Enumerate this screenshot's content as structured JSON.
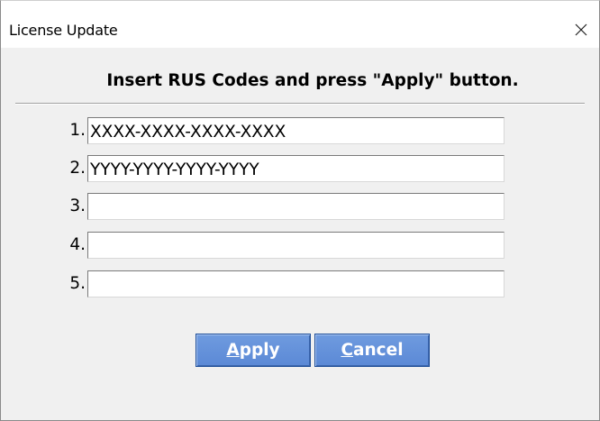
{
  "window": {
    "title": "License Update",
    "close_glyph": "✕"
  },
  "dialog": {
    "heading": "Insert RUS Codes and press \"Apply\" button.",
    "codes": [
      {
        "number": "1.",
        "value": "XXXX-XXXX-XXXX-XXXX"
      },
      {
        "number": "2.",
        "value": "YYYY-YYYY-YYYY-YYYY"
      },
      {
        "number": "3.",
        "value": ""
      },
      {
        "number": "4.",
        "value": ""
      },
      {
        "number": "5.",
        "value": ""
      }
    ],
    "apply_label": "Apply",
    "cancel_label": "Cancel"
  },
  "icons": {
    "close": "close-icon"
  },
  "colors": {
    "button_bg": "#6390d9",
    "button_text": "#ffffff",
    "client_bg": "#f0f0f0"
  }
}
